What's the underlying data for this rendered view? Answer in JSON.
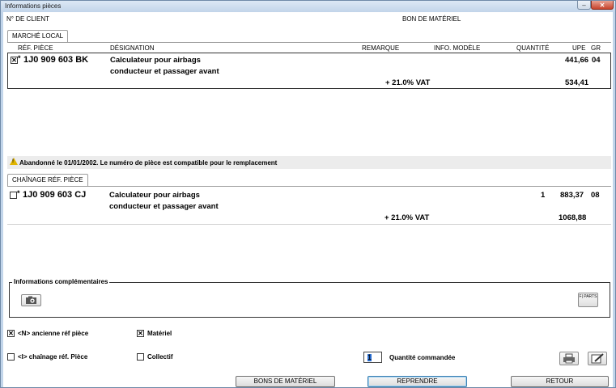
{
  "window": {
    "title": "Informations pièces"
  },
  "header": {
    "client_label": "N° DE CLIENT",
    "doc_label": "BON DE MATÉRIEL"
  },
  "tabs": {
    "local": "MARCHÉ LOCAL",
    "chain": "CHAÎNAGE RÉF. PIÈCE"
  },
  "columns": {
    "ref": "RÉF. PIÈCE",
    "designation": "DÉSIGNATION",
    "remark": "REMARQUE",
    "model": "INFO. MODÈLE",
    "qty": "QUANTITÉ",
    "upe": "UPE",
    "gr": "GR"
  },
  "part1": {
    "ref": "1J0 909 603 BK",
    "line1": "Calculateur pour airbags",
    "line2": "conducteur et passager avant",
    "upe": "441,66",
    "gr": "04",
    "vat_label": "+ 21.0% VAT",
    "vat_value": "534,41"
  },
  "warning": {
    "text": "Abandonné le 01/01/2002. Le numéro de pièce est compatible pour le remplacement"
  },
  "part2": {
    "ref": "1J0 909 603 CJ",
    "line1": "Calculateur pour airbags",
    "line2": "conducteur et passager avant",
    "qty": "1",
    "upe": "883,37",
    "gr": "08",
    "vat_label": "+ 21.0% VAT",
    "vat_value": "1068,88"
  },
  "info": {
    "title": "Informations complémentaires",
    "parts_badge": "F| PARTS"
  },
  "options": {
    "old_ref": "<N> ancienne réf pièce",
    "materiel": "Matériel",
    "chain_ref": "<I> chaînage réf. Pièce",
    "collectif": "Collectif"
  },
  "quantity": {
    "label": "Quantité commandée",
    "value": "1"
  },
  "buttons": {
    "bons": "BONS DE MATÉRIEL",
    "reprendre": "REPRENDRE",
    "retour": "RETOUR"
  }
}
